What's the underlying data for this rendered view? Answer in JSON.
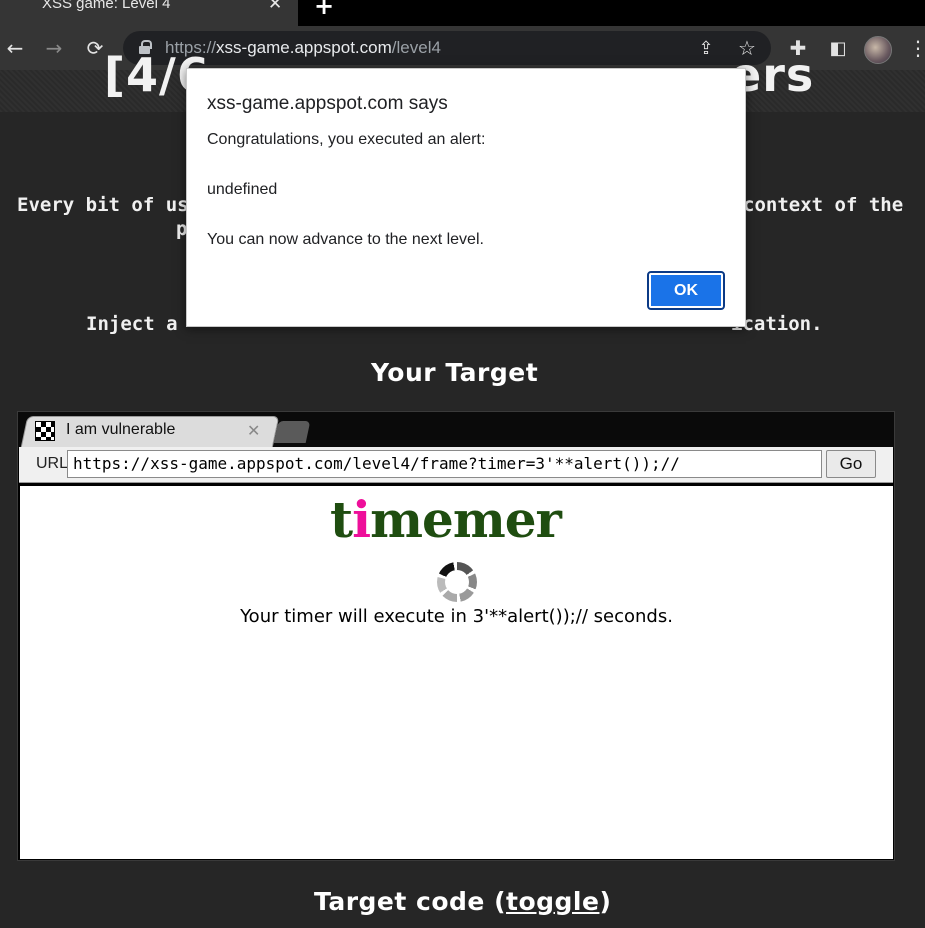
{
  "browser": {
    "tab_title": "XSS game: Level 4",
    "tab_close": "✕",
    "new_tab": "+",
    "url_scheme": "https://",
    "url_host": "xss-game.appspot.com",
    "url_path": "/level4",
    "icons": [
      "back-icon",
      "forward-icon",
      "reload-icon",
      "lock-icon",
      "share-icon",
      "star-icon",
      "extensions-icon",
      "sidepanel-icon",
      "avatar",
      "menu-icon"
    ]
  },
  "page": {
    "banner_left": "[4/6",
    "banner_right": "ers",
    "desc_line1_left": "Every bit of use",
    "desc_line1_right": "context of the",
    "desc_line2": "p",
    "inject_left": "Inject a",
    "inject_right": "ication.",
    "your_target": "Your Target",
    "target_code": "Target code (",
    "toggle": "toggle",
    "target_code_end": ")"
  },
  "inner_browser": {
    "tab_title": "I am vulnerable",
    "tab_close": "✕",
    "url_label": "URL",
    "url_value": "https://xss-game.appspot.com/level4/frame?timer=3'**alert());//",
    "go_label": "Go",
    "logo_ti_t": "t",
    "logo_ti_i": "i",
    "logo_rest": "memer",
    "timer_message": "Your timer will execute in 3'**alert());// seconds."
  },
  "dialog": {
    "origin": "xss-game.appspot.com says",
    "line1": "Congratulations, you executed an alert:",
    "line2": "undefined",
    "line3": "You can now advance to the next level.",
    "ok_label": "OK",
    "accent": "#1a73e8"
  }
}
